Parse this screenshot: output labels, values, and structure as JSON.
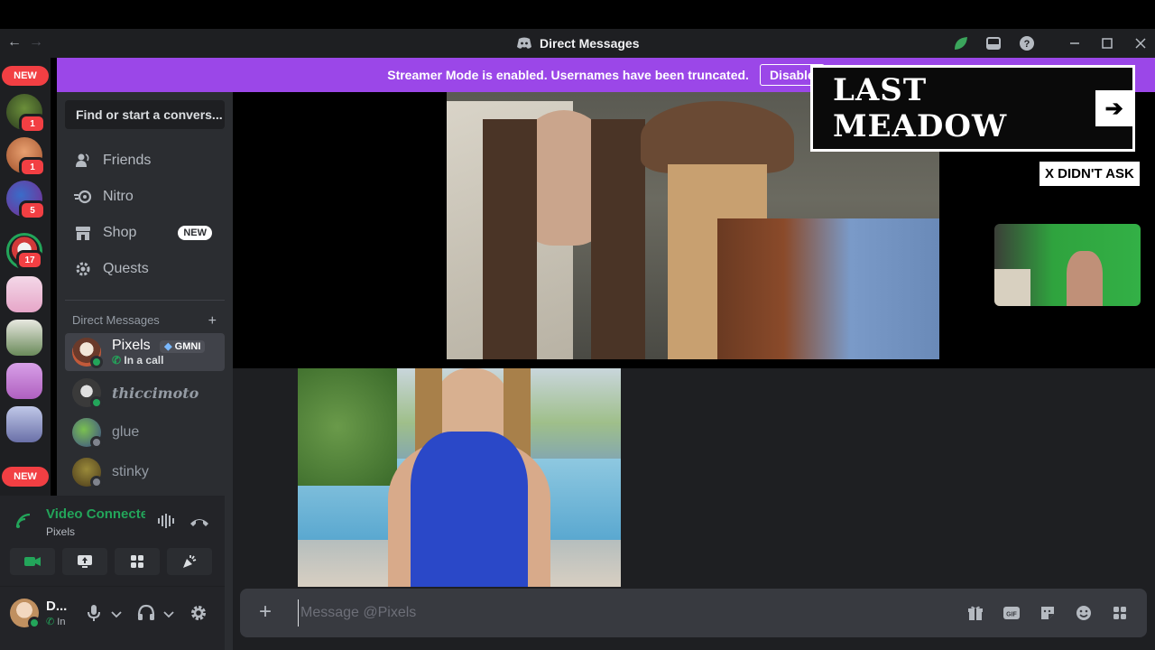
{
  "titlebar": {
    "title": "Direct Messages",
    "back_icon": "←",
    "forward_icon": "→"
  },
  "servers": {
    "new_label": "NEW",
    "badges": [
      "1",
      "1",
      "5",
      "17"
    ]
  },
  "banner": {
    "text": "Streamer Mode is enabled. Usernames have been truncated.",
    "button": "Disable"
  },
  "sidebar": {
    "search_placeholder": "Find or start a convers...",
    "nav": [
      {
        "label": "Friends"
      },
      {
        "label": "Nitro"
      },
      {
        "label": "Shop",
        "tag": "NEW"
      },
      {
        "label": "Quests"
      }
    ],
    "dm_header": "Direct Messages",
    "dm_add": "+",
    "dms": [
      {
        "name": "Pixels",
        "tag": "GMNI",
        "sub": "In a call"
      },
      {
        "name": "thiccimoto"
      },
      {
        "name": "glue"
      },
      {
        "name": "stinky"
      }
    ]
  },
  "voice": {
    "title": "Video Connected",
    "subtitle": "Pixels"
  },
  "user": {
    "name": "D...",
    "status": "In"
  },
  "stream": {
    "logo_text": "LAST MEADOW",
    "logo_arrow": "➔",
    "didnt_ask": "X DIDN'T ASK"
  },
  "composer": {
    "plus": "+",
    "placeholder": "Message @Pixels"
  },
  "colors": {
    "accent": "#9b47e8",
    "online": "#23a55a",
    "badge": "#f23f43"
  }
}
